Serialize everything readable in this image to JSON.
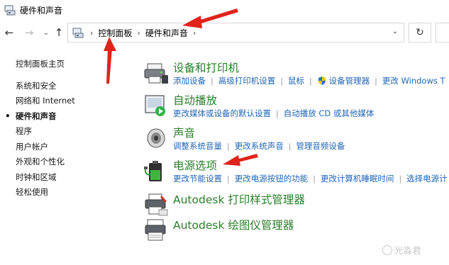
{
  "window": {
    "title": "硬件和声音",
    "icon": "control-panel-icon"
  },
  "navigation": {
    "back": "←",
    "forward": "→",
    "up": "↑",
    "refresh": "↻",
    "dropdown": "⌄",
    "breadcrumbs": [
      "控制面板",
      "硬件和声音"
    ]
  },
  "sidebar": {
    "items": [
      {
        "label": "控制面板主页"
      },
      {
        "label": "系统和安全"
      },
      {
        "label": "网络和 Internet"
      },
      {
        "label": "硬件和声音",
        "active": true
      },
      {
        "label": "程序"
      },
      {
        "label": "用户帐户"
      },
      {
        "label": "外观和个性化"
      },
      {
        "label": "时钟和区域"
      },
      {
        "label": "轻松使用"
      }
    ],
    "active_marker": "•"
  },
  "categories": [
    {
      "title": "设备和打印机",
      "icon": "printer-device-icon",
      "links": [
        "添加设备",
        "高级打印机设置",
        "鼠标",
        "设备管理器",
        "更改 Windows T"
      ]
    },
    {
      "title": "自动播放",
      "icon": "autoplay-icon",
      "links": [
        "更改媒体或设备的默认设置",
        "自动播放 CD 或其他媒体"
      ]
    },
    {
      "title": "声音",
      "icon": "speaker-icon",
      "links": [
        "调整系统音量",
        "更改系统声音",
        "管理音频设备"
      ]
    },
    {
      "title": "电源选项",
      "icon": "battery-power-icon",
      "links": [
        "更改节能设置",
        "更改电源按钮的功能",
        "更改计算机睡眠时间",
        "选择电源计"
      ]
    },
    {
      "title": "Autodesk 打印样式管理器",
      "icon": "autodesk-print-style-icon",
      "links": []
    },
    {
      "title": "Autodesk 绘图仪管理器",
      "icon": "autodesk-plotter-icon",
      "links": []
    }
  ],
  "colors": {
    "category_title": "#2a7f2a",
    "link": "#1f66b8",
    "annotation_arrow": "#e0231b"
  },
  "watermark": "光淼君"
}
